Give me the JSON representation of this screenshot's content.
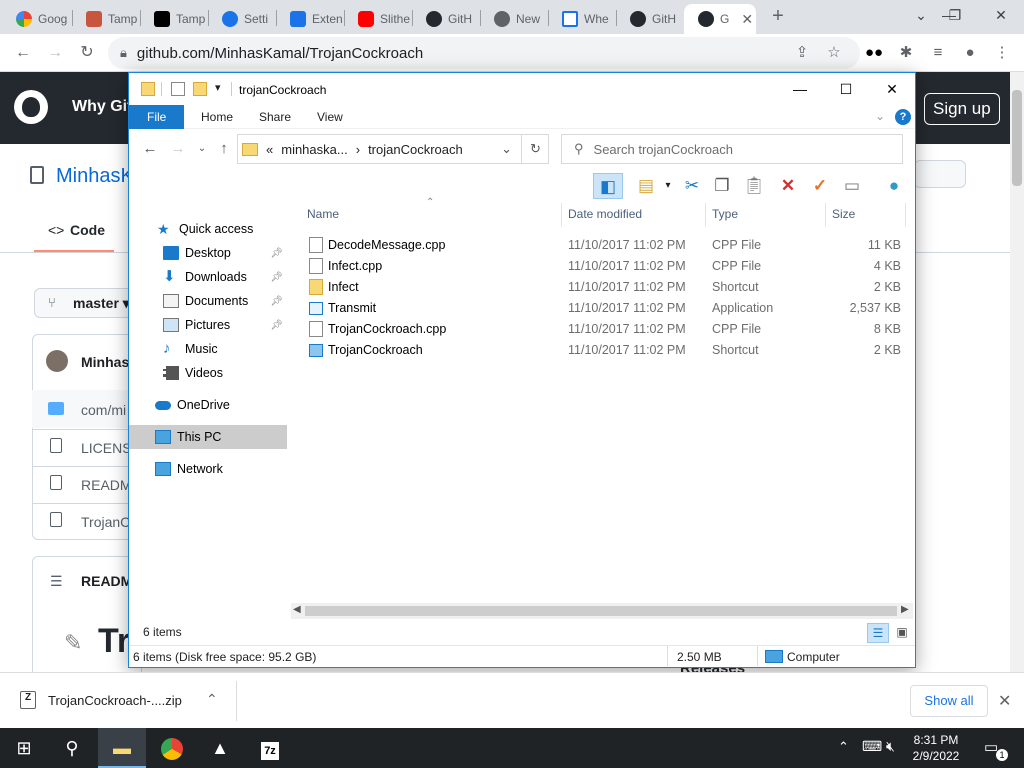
{
  "browser": {
    "tabs": [
      {
        "label": "Goog",
        "color": "#4285f4"
      },
      {
        "label": "Tamp",
        "color": "#c8553d"
      },
      {
        "label": "Tamp",
        "color": "#000000"
      },
      {
        "label": "Setti",
        "color": "#1a73e8"
      },
      {
        "label": "Exten",
        "color": "#1a73e8"
      },
      {
        "label": "Slithe",
        "color": "#ff0000"
      },
      {
        "label": "GitH",
        "color": "#24292f"
      },
      {
        "label": "New",
        "color": "#5f6368"
      },
      {
        "label": "Whe",
        "color": "#1a73e8"
      },
      {
        "label": "GitH",
        "color": "#24292f"
      },
      {
        "label": "G",
        "color": "#24292f"
      }
    ],
    "url": "github.com/MinhasKamal/TrojanCockroach"
  },
  "github": {
    "nav_item": "Why Git",
    "signup": "Sign up",
    "repo_name": "MinhasK",
    "code_tab": "Code",
    "branch": "master",
    "author": "Minhas",
    "rows": [
      "com/mi",
      "LICENSE",
      "READM",
      "TrojanCo"
    ],
    "readme": "README",
    "title": "Tr",
    "releases": "Releases"
  },
  "explorer": {
    "title": "trojanCockroach",
    "ribbon_tabs": [
      "File",
      "Home",
      "Share",
      "View"
    ],
    "breadcrumb": [
      "«",
      "minhaska...",
      "›",
      "trojanCockroach"
    ],
    "search_placeholder": "Search trojanCockroach",
    "nav_pane": [
      {
        "label": "Quick access",
        "icon": "star-icon",
        "pinned": false
      },
      {
        "label": "Desktop",
        "icon": "desktop-icon",
        "pinned": true
      },
      {
        "label": "Downloads",
        "icon": "download-icon",
        "pinned": true
      },
      {
        "label": "Documents",
        "icon": "documents-icon",
        "pinned": true
      },
      {
        "label": "Pictures",
        "icon": "pictures-icon",
        "pinned": true
      },
      {
        "label": "Music",
        "icon": "music-icon",
        "pinned": false
      },
      {
        "label": "Videos",
        "icon": "videos-icon",
        "pinned": false
      },
      {
        "label": "OneDrive",
        "icon": "cloud-icon",
        "pinned": false
      },
      {
        "label": "This PC",
        "icon": "computer-icon",
        "pinned": false
      },
      {
        "label": "Network",
        "icon": "network-icon",
        "pinned": false
      }
    ],
    "columns": {
      "name": "Name",
      "date": "Date modified",
      "type": "Type",
      "size": "Size"
    },
    "files": [
      {
        "name": "DecodeMessage.cpp",
        "date": "11/10/2017 11:02 PM",
        "type": "CPP File",
        "size": "11 KB"
      },
      {
        "name": "Infect.cpp",
        "date": "11/10/2017 11:02 PM",
        "type": "CPP File",
        "size": "4 KB"
      },
      {
        "name": "Infect",
        "date": "11/10/2017 11:02 PM",
        "type": "Shortcut",
        "size": "2 KB"
      },
      {
        "name": "Transmit",
        "date": "11/10/2017 11:02 PM",
        "type": "Application",
        "size": "2,537 KB"
      },
      {
        "name": "TrojanCockroach.cpp",
        "date": "11/10/2017 11:02 PM",
        "type": "CPP File",
        "size": "8 KB"
      },
      {
        "name": "TrojanCockroach",
        "date": "11/10/2017 11:02 PM",
        "type": "Shortcut",
        "size": "2 KB"
      }
    ],
    "item_count": "6 items",
    "status_left": "6 items (Disk free space: 95.2 GB)",
    "status_size": "2.50 MB",
    "status_location": "Computer"
  },
  "download": {
    "filename": "TrojanCockroach-....zip",
    "show_all": "Show all"
  },
  "taskbar": {
    "time": "8:31 PM",
    "date": "2/9/2022",
    "notification_count": "1"
  }
}
